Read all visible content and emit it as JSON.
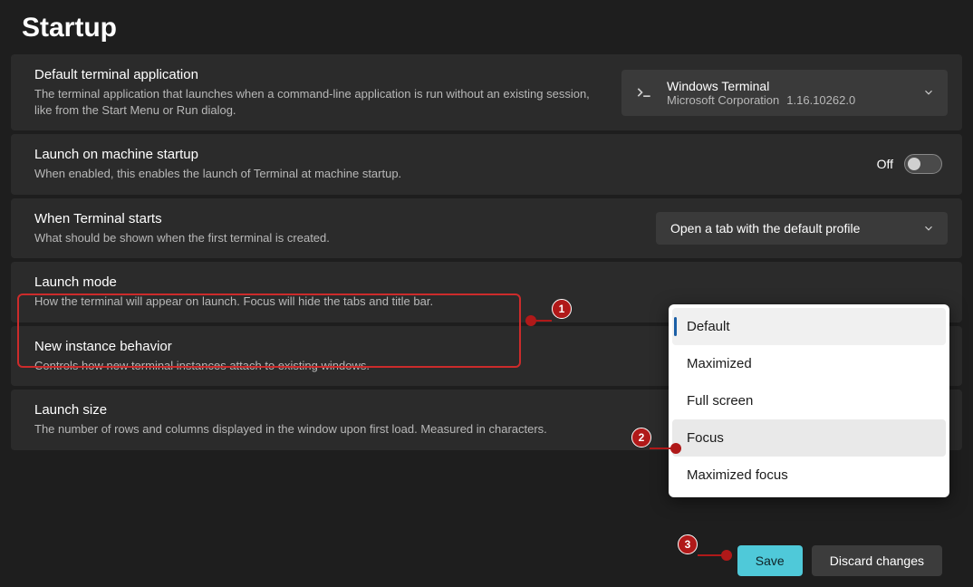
{
  "title": "Startup",
  "rows": {
    "default_terminal": {
      "title": "Default terminal application",
      "desc": "The terminal application that launches when a command-line application is run without an existing session, like from the Start Menu or Run dialog.",
      "value_title": "Windows Terminal",
      "value_publisher": "Microsoft Corporation",
      "value_version": "1.16.10262.0"
    },
    "launch_on_startup": {
      "title": "Launch on machine startup",
      "desc": "When enabled, this enables the launch of Terminal at machine startup.",
      "toggle_state": "Off"
    },
    "when_starts": {
      "title": "When Terminal starts",
      "desc": "What should be shown when the first terminal is created.",
      "value": "Open a tab with the default profile"
    },
    "launch_mode": {
      "title": "Launch mode",
      "desc": "How the terminal will appear on launch. Focus will hide the tabs and title bar."
    },
    "new_instance": {
      "title": "New instance behavior",
      "desc": "Controls how new terminal instances attach to existing windows."
    },
    "launch_size": {
      "title": "Launch size",
      "desc": "The number of rows and columns displayed in the window upon first load. Measured in characters."
    }
  },
  "launch_mode_options": [
    "Default",
    "Maximized",
    "Full screen",
    "Focus",
    "Maximized focus"
  ],
  "footer": {
    "save": "Save",
    "discard": "Discard changes"
  },
  "annotations": {
    "b1": "1",
    "b2": "2",
    "b3": "3"
  }
}
